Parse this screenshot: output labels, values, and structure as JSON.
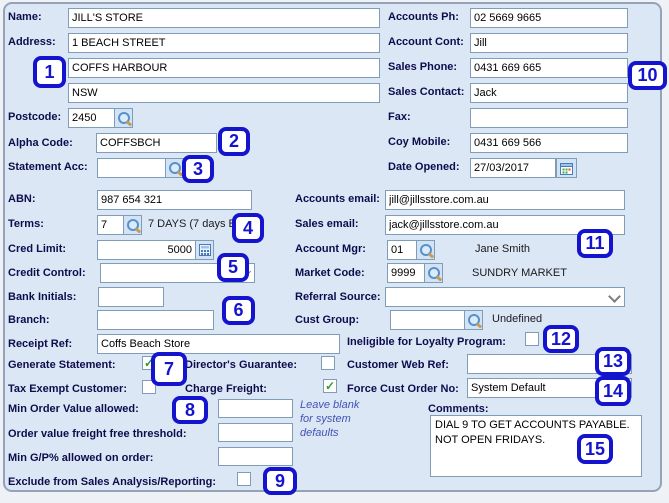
{
  "left": {
    "name_label": "Name:",
    "name_value": "JILL'S STORE",
    "address_label": "Address:",
    "address1": "1 BEACH STREET",
    "address2": "COFFS HARBOUR",
    "address3": "NSW",
    "postcode_label": "Postcode:",
    "postcode_value": "2450",
    "alpha_code_label": "Alpha Code:",
    "alpha_code_value": "COFFSBCH",
    "statement_acc_label": "Statement Acc:",
    "statement_acc_value": "",
    "abn_label": "ABN:",
    "abn_value": "987 654 321",
    "terms_label": "Terms:",
    "terms_value": "7",
    "terms_desc": "7 DAYS (7 days EOM)",
    "cred_limit_label": "Cred Limit:",
    "cred_limit_value": "5000",
    "credit_control_label": "Credit Control:",
    "credit_control_value": "",
    "bank_initials_label": "Bank Initials:",
    "bank_initials_value": "",
    "branch_label": "Branch:",
    "branch_value": "",
    "receipt_ref_label": "Receipt Ref:",
    "receipt_ref_value": "Coffs Beach Store",
    "generate_statement_label": "Generate Statement:",
    "directors_guarantee_label": "Director's Guarantee:",
    "tax_exempt_label": "Tax Exempt Customer:",
    "charge_freight_label": "Charge Freight:",
    "min_order_label": "Min Order Value allowed:",
    "min_order_value": "",
    "freight_free_label": "Order value freight free threshold:",
    "freight_free_value": "",
    "min_gp_label": "Min G/P% allowed on order:",
    "min_gp_value": "",
    "exclude_label": "Exclude from Sales Analysis/Reporting:",
    "hint_text": "Leave blank for system defaults"
  },
  "right": {
    "accounts_ph_label": "Accounts Ph:",
    "accounts_ph_value": "02 5669 9665",
    "account_cont_label": "Account Cont:",
    "account_cont_value": "Jill",
    "sales_phone_label": "Sales Phone:",
    "sales_phone_value": "0431 669 665",
    "sales_contact_label": "Sales Contact:",
    "sales_contact_value": "Jack",
    "fax_label": "Fax:",
    "fax_value": "",
    "coy_mobile_label": "Coy Mobile:",
    "coy_mobile_value": "0431 669 566",
    "date_opened_label": "Date Opened:",
    "date_opened_value": "27/03/2017",
    "accounts_email_label": "Accounts email:",
    "accounts_email_value": "jill@jillsstore.com.au",
    "sales_email_label": "Sales email:",
    "sales_email_value": "jack@jillsstore.com.au",
    "account_mgr_label": "Account Mgr:",
    "account_mgr_value": "01",
    "account_mgr_name": "Jane Smith",
    "market_code_label": "Market Code:",
    "market_code_value": "9999",
    "market_code_name": "SUNDRY MARKET",
    "referral_source_label": "Referral Source:",
    "referral_source_value": "",
    "cust_group_label": "Cust Group:",
    "cust_group_value": "",
    "cust_group_name": "Undefined",
    "loyalty_label": "Ineligible for Loyalty Program:",
    "web_ref_label": "Customer Web Ref:",
    "web_ref_value": "",
    "force_cust_label": "Force Cust Order No:",
    "force_cust_value": "System Default",
    "comments_label": "Comments:",
    "comments_line1": "DIAL 9 TO GET ACCOUNTS PAYABLE.",
    "comments_line2": "NOT OPEN FRIDAYS."
  },
  "checkboxes": {
    "generate_statement": true,
    "directors_guarantee": false,
    "tax_exempt": false,
    "charge_freight": true,
    "loyalty": false,
    "exclude_sales_analysis": false
  },
  "callouts": {
    "labels": [
      "1",
      "2",
      "3",
      "4",
      "5",
      "6",
      "7",
      "8",
      "9",
      "10",
      "11",
      "12",
      "13",
      "14",
      "15"
    ]
  },
  "colors": {
    "callout_blue": "#1414cf",
    "panel_background": "#dce7f5",
    "label_navy": "#0d0d4d",
    "hint_blue": "#4153b5",
    "check_green": "#2e9e2e"
  }
}
